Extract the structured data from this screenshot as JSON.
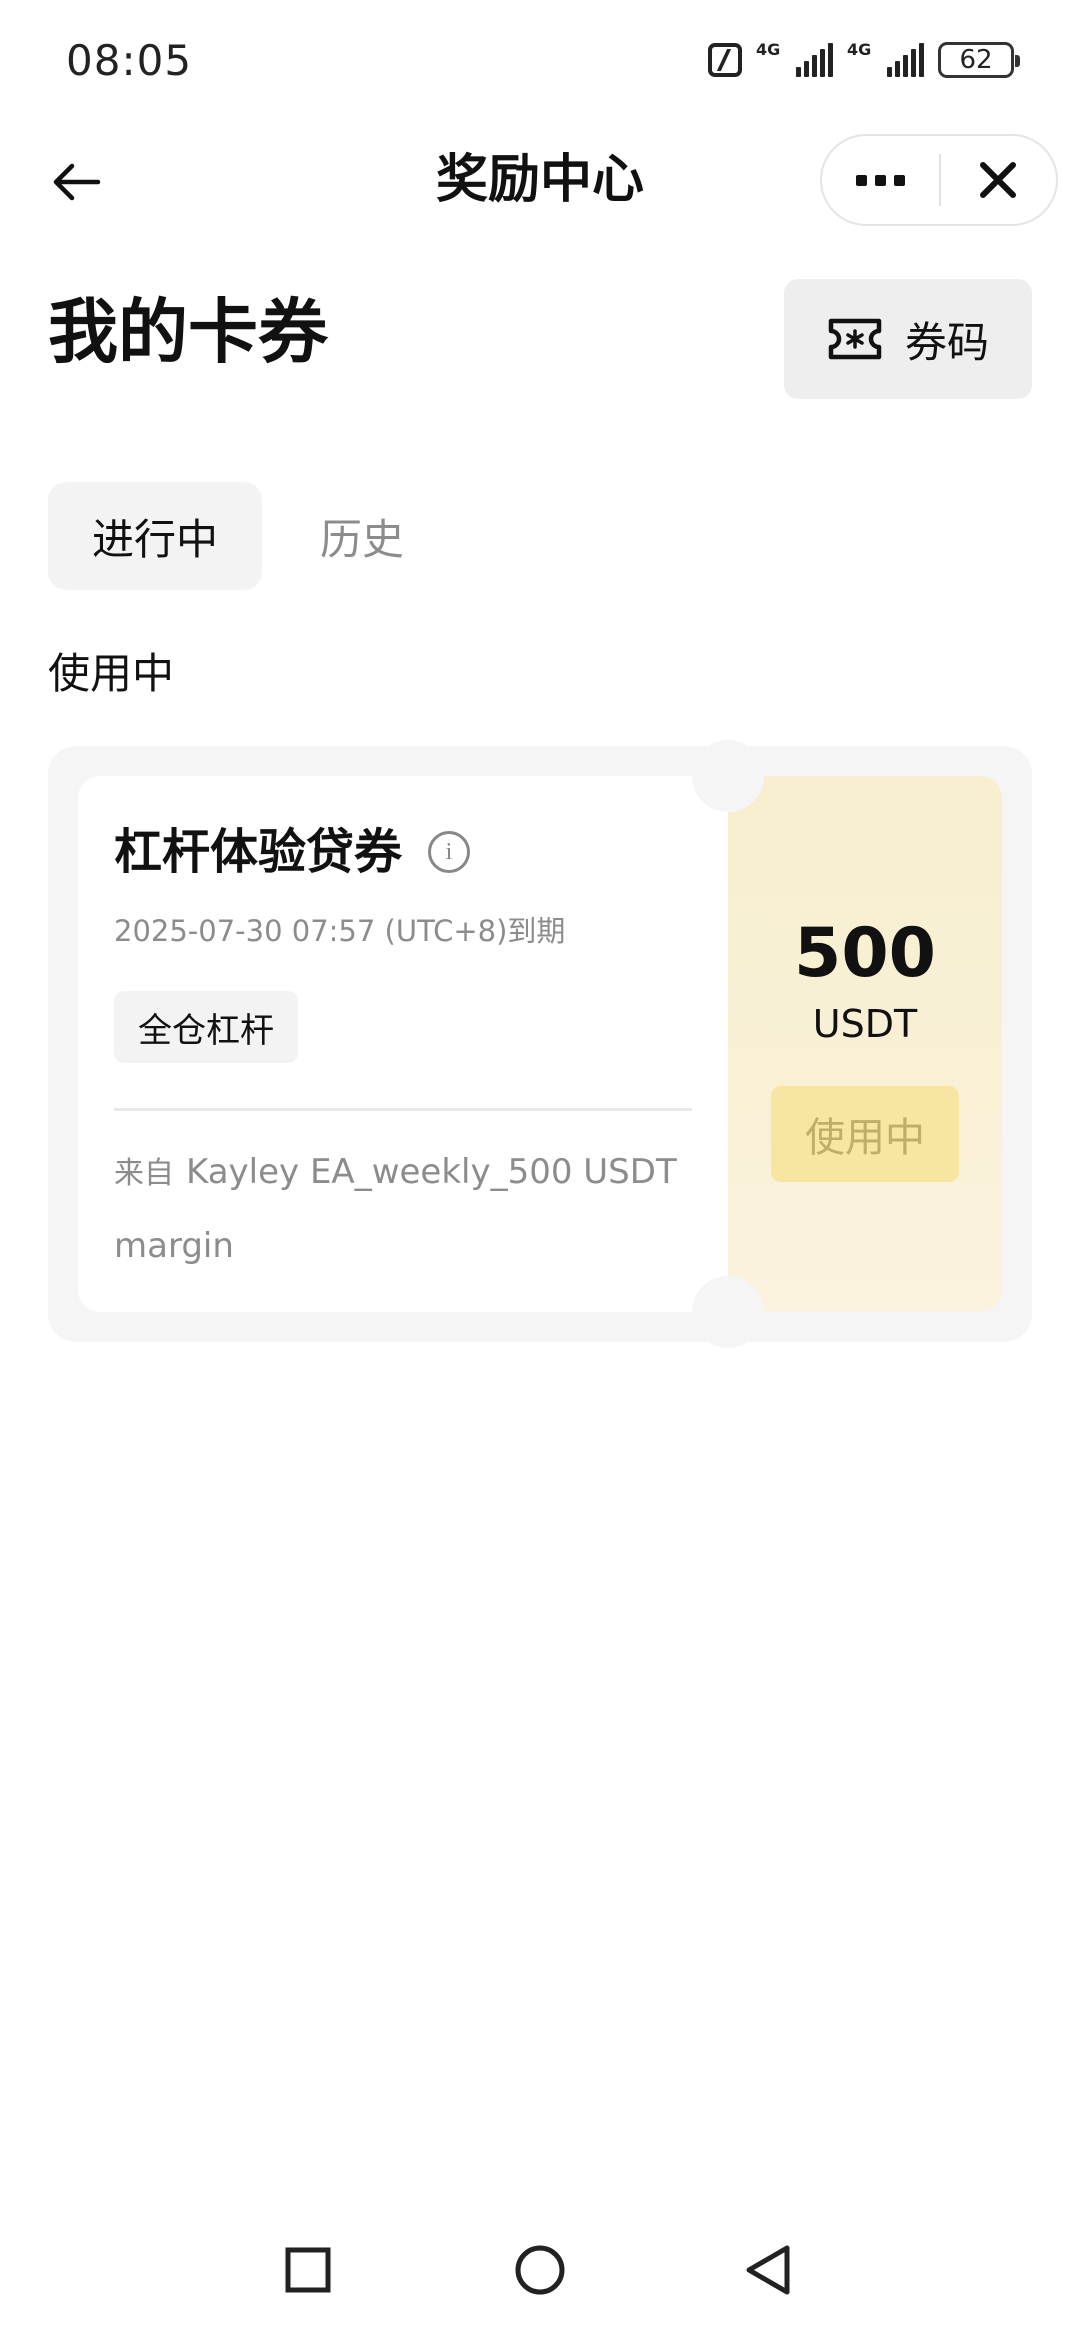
{
  "status_bar": {
    "time": "08:05",
    "network_1": "4G",
    "network_2": "4G",
    "battery": "62"
  },
  "header": {
    "title": "奖励中心",
    "back_icon": "arrow-left-icon",
    "more_icon": "more-dots-icon",
    "close_icon": "close-x-icon"
  },
  "page": {
    "title": "我的卡券",
    "code_button_label": "券码",
    "code_button_icon": "ticket-star-icon"
  },
  "tabs": [
    {
      "label": "进行中",
      "active": true
    },
    {
      "label": "历史",
      "active": false
    }
  ],
  "section_label": "使用中",
  "coupon": {
    "title": "杠杆体验贷券",
    "info_icon": "info-icon",
    "expiry": "2025-07-30 07:57 (UTC+8)到期",
    "tag": "全仓杠杆",
    "source_prefix": "来自",
    "source_name": "Kayley EA_weekly_500 USDT margin",
    "amount": "500",
    "currency": "USDT",
    "status": "使用中"
  },
  "nav_bar": {
    "recents_icon": "square-icon",
    "home_icon": "circle-icon",
    "back_icon": "triangle-back-icon"
  },
  "colors": {
    "accent_bg": "#f7efcf",
    "status_pill": "#f7e6a2",
    "muted_text": "#8c8c8c"
  }
}
